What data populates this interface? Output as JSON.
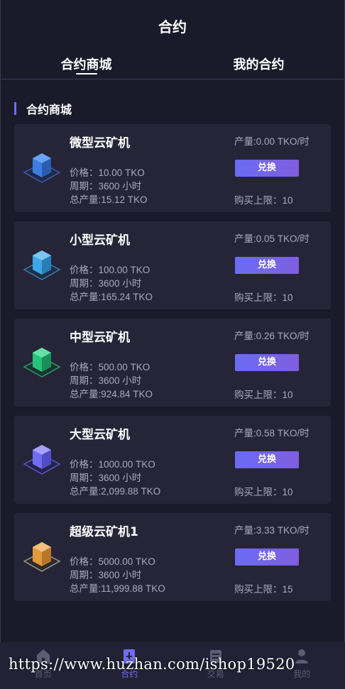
{
  "header": {
    "title": "合约"
  },
  "tabs": [
    {
      "label": "合约商城",
      "active": true
    },
    {
      "label": "我的合约",
      "active": false
    }
  ],
  "section": {
    "title": "合约商城"
  },
  "products": [
    {
      "name": "微型云矿机",
      "price": "价格：10.00 TKO",
      "cycle": "周期：3600 小时",
      "total": "总产量:15.12 TKO",
      "output": "产量:0.00 TKO/时",
      "button": "兑换",
      "limit": "购买上限：10",
      "color": "#3d7ee0"
    },
    {
      "name": "小型云矿机",
      "price": "价格：100.00 TKO",
      "cycle": "周期：3600 小时",
      "total": "总产量:165.24 TKO",
      "output": "产量:0.05 TKO/时",
      "button": "兑换",
      "limit": "购买上限：10",
      "color": "#3da7e8"
    },
    {
      "name": "中型云矿机",
      "price": "价格：500.00 TKO",
      "cycle": "周期：3600 小时",
      "total": "总产量:924.84 TKO",
      "output": "产量:0.26 TKO/时",
      "button": "兑换",
      "limit": "购买上限：10",
      "color": "#27c27a"
    },
    {
      "name": "大型云矿机",
      "price": "价格：1000.00 TKO",
      "cycle": "周期：3600 小时",
      "total": "总产量:2,099.88 TKO",
      "output": "产量:0.58 TKO/时",
      "button": "兑换",
      "limit": "购买上限：10",
      "color": "#6f6cf2"
    },
    {
      "name": "超级云矿机1",
      "price": "价格：5000.00 TKO",
      "cycle": "周期：3600 小时",
      "total": "总产量:11,999.88 TKO",
      "output": "产量:3.33 TKO/时",
      "button": "兑换",
      "limit": "购买上限：15",
      "color": "#e39a3c"
    }
  ],
  "tabbar": [
    {
      "label": "首页",
      "icon": "home-icon",
      "active": false
    },
    {
      "label": "合约",
      "icon": "contract-icon",
      "active": true
    },
    {
      "label": "交易",
      "icon": "trade-icon",
      "active": false
    },
    {
      "label": "我的",
      "icon": "user-icon",
      "active": false
    }
  ],
  "watermark": "https://www.huzhan.com/ishop19520"
}
